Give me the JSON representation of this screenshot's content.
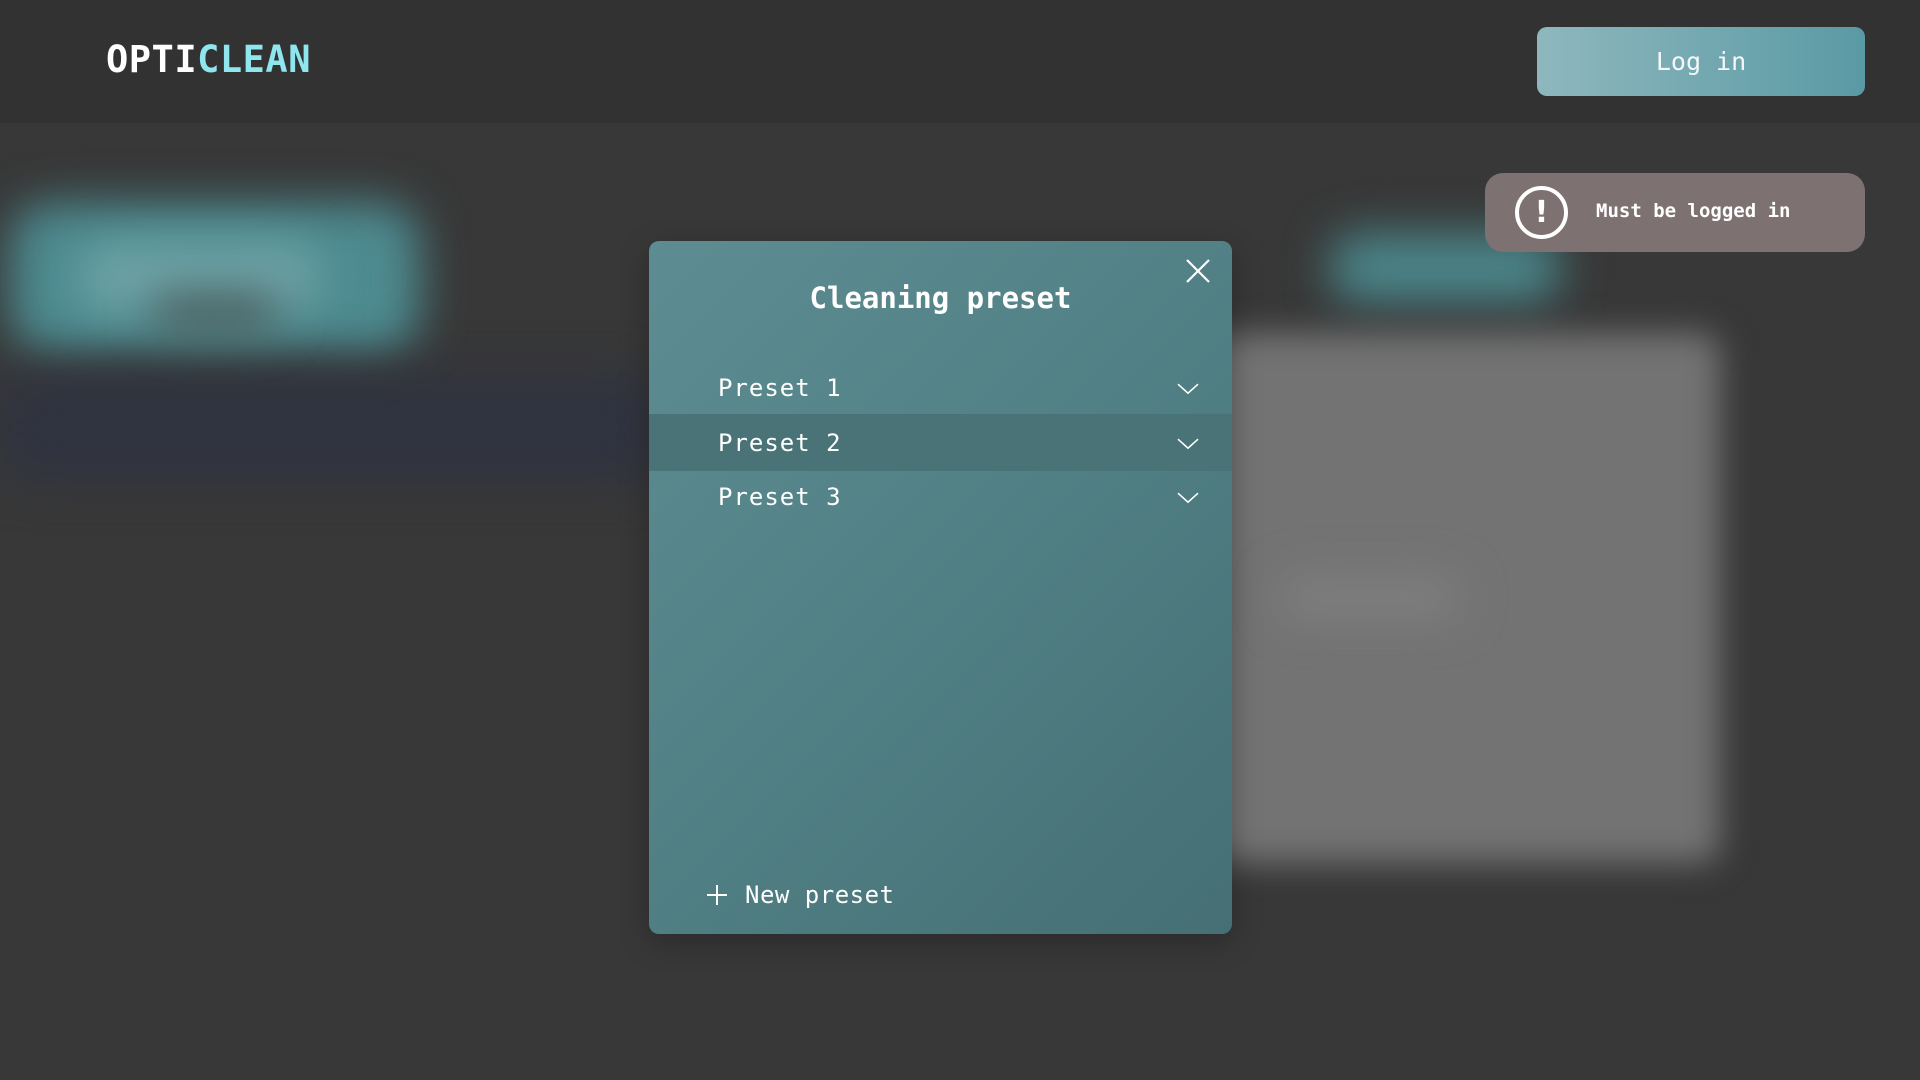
{
  "header": {
    "logo_part1": "OPTI",
    "logo_part2": "CLEAN",
    "login_label": "Log in"
  },
  "toast": {
    "icon": "exclamation-circle-icon",
    "message": "Must be logged in"
  },
  "modal": {
    "title": "Cleaning preset",
    "presets": [
      {
        "label": "Preset 1",
        "selected": false
      },
      {
        "label": "Preset 2",
        "selected": true
      },
      {
        "label": "Preset 3",
        "selected": false
      }
    ],
    "new_preset_label": "New preset"
  },
  "colors": {
    "accent": "#8fe6ee",
    "modal_bg": "#5a898e",
    "toast_bg": "#7d7172"
  }
}
